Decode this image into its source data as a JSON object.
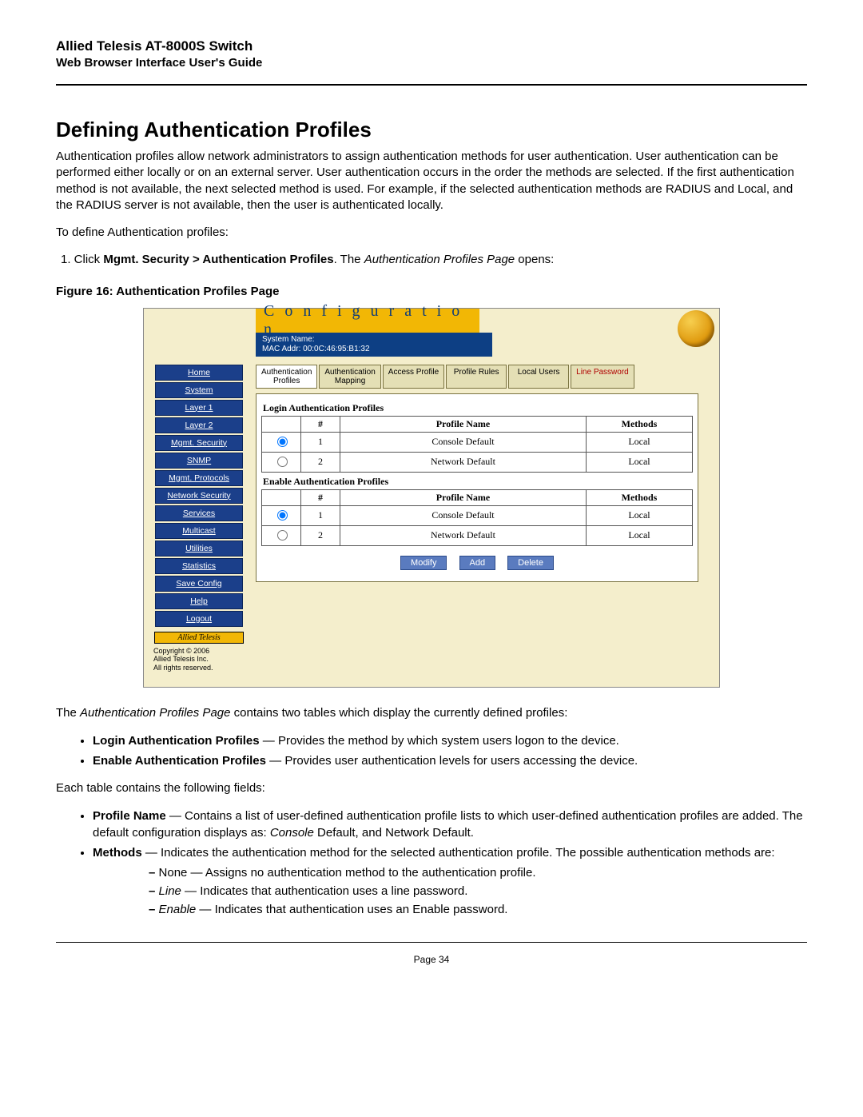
{
  "header": {
    "title": "Allied Telesis AT-8000S Switch",
    "subtitle": "Web Browser Interface User's Guide"
  },
  "section_heading": "Defining Authentication Profiles",
  "intro_para": "Authentication profiles allow network administrators to assign authentication methods for user authentication. User authentication can be performed either locally or on an external server. User authentication occurs in the order the methods are selected. If the first authentication method is not available, the next selected method is used. For example, if the selected authentication methods are RADIUS and Local, and the RADIUS server is not available, then the user is authenticated locally.",
  "lead_line": "To define Authentication profiles:",
  "step1_prefix": "1.   Click ",
  "step1_bold": "Mgmt. Security > Authentication Profiles",
  "step1_mid": ". The ",
  "step1_italic": "Authentication Profiles Page",
  "step1_suffix": " opens:",
  "figure_caption": "Figure 16:  Authentication Profiles Page",
  "ui": {
    "conf_title": "C o n f i g u r a t i o n",
    "sys_name_label": "System Name:",
    "mac_line": "MAC Addr: 00:0C:46:95:B1:32",
    "nav": [
      "Home",
      "System",
      "Layer 1",
      "Layer 2",
      "Mgmt. Security",
      "SNMP",
      "Mgmt. Protocols",
      "Network Security",
      "Services",
      "Multicast",
      "Utilities",
      "Statistics",
      "Save Config",
      "Help",
      "Logout"
    ],
    "brand": "Allied Telesis",
    "copyright": "Copyright © 2006\nAllied Telesis  Inc.\nAll rights reserved.",
    "tabs": [
      {
        "l1": "Authentication",
        "l2": "Profiles",
        "active": true
      },
      {
        "l1": "Authentication",
        "l2": "Mapping"
      },
      {
        "l1": "Access Profile",
        "l2": ""
      },
      {
        "l1": "Profile Rules",
        "l2": ""
      },
      {
        "l1": "Local Users",
        "l2": ""
      },
      {
        "l1": "Line Password",
        "l2": "",
        "highlight": true
      }
    ],
    "login_title": "Login Authentication Profiles",
    "enable_title": "Enable Authentication Profiles",
    "cols": {
      "num": "#",
      "name": "Profile Name",
      "methods": "Methods"
    },
    "login_rows": [
      {
        "sel": true,
        "n": "1",
        "name": "Console Default",
        "method": "Local"
      },
      {
        "sel": false,
        "n": "2",
        "name": "Network Default",
        "method": "Local"
      }
    ],
    "enable_rows": [
      {
        "sel": true,
        "n": "1",
        "name": "Console Default",
        "method": "Local"
      },
      {
        "sel": false,
        "n": "2",
        "name": "Network Default",
        "method": "Local"
      }
    ],
    "buttons": {
      "modify": "Modify",
      "add": "Add",
      "delete": "Delete"
    }
  },
  "after_fig_para_prefix": "The ",
  "after_fig_para_italic": "Authentication Profiles Page",
  "after_fig_para_suffix": " contains two tables which display the currently defined profiles:",
  "bullets1": [
    {
      "bold": "Login Authentication Profiles",
      "rest": " — Provides the method by which system users logon to the device."
    },
    {
      "bold": "Enable Authentication Profiles",
      "rest": " — Provides user authentication levels for users accessing the device."
    }
  ],
  "fields_lead": "Each table contains the following fields:",
  "bullets2": [
    {
      "bold": "Profile Name",
      "rest_pre": " — Contains a list of user-defined authentication profile lists to which user-defined authentication profiles are added. The default configuration displays as: ",
      "italic": "Console",
      "rest_post": " Default, and Network Default."
    },
    {
      "bold": "Methods",
      "rest_pre": " — Indicates the authentication method for the selected authentication profile. The possible authentication methods are:",
      "italic": "",
      "rest_post": ""
    }
  ],
  "dash_items": [
    {
      "plain": "None — Assigns no authentication method to the authentication profile."
    },
    {
      "italic": "Line",
      "rest": " — Indicates that authentication uses a line password."
    },
    {
      "italic": "Enable",
      "rest": " — Indicates that authentication uses an Enable password."
    }
  ],
  "page_number": "Page 34"
}
